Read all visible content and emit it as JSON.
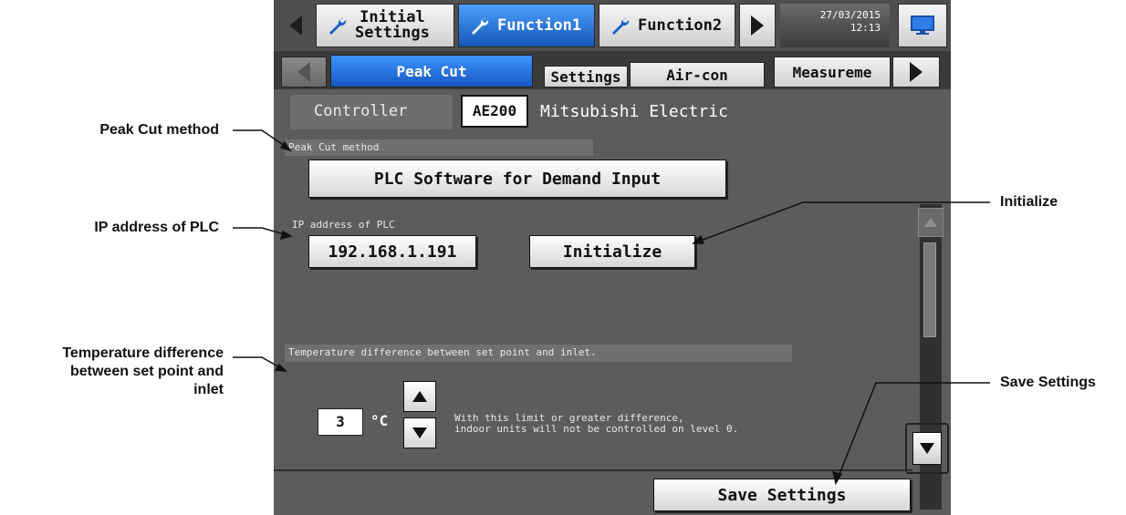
{
  "annotations": {
    "peak_cut_method": "Peak Cut method",
    "ip_address": "IP address of PLC",
    "temp_diff_line1": "Temperature difference",
    "temp_diff_line2": "between set point and",
    "temp_diff_line3": "inlet",
    "initialize": "Initialize",
    "save_settings": "Save Settings"
  },
  "header": {
    "tabs": [
      {
        "line1": "Initial",
        "line2": "Settings"
      },
      {
        "label": "Function1",
        "selected": true
      },
      {
        "label": "Function2"
      }
    ],
    "date": "27/03/2015",
    "time": "12:13",
    "monitor_icon": "monitor-icon"
  },
  "subtabs": {
    "title": "Peak Cut",
    "items": [
      "Settings",
      "Air-con",
      "Measureme"
    ]
  },
  "controller": {
    "label": "Controller",
    "model": "AE200",
    "maker": "Mitsubishi Electric"
  },
  "peak_cut": {
    "section_label": "Peak Cut method",
    "method_value": "PLC Software for Demand Input"
  },
  "ip": {
    "section_label": "IP address of PLC",
    "value": "192.168.1.191",
    "initialize_label": "Initialize"
  },
  "temperature": {
    "section_label": "Temperature difference between set point and inlet.",
    "value": "3",
    "unit": "°C",
    "note_line1": "With this limit or greater difference,",
    "note_line2": "indoor units will not be controlled on level 0."
  },
  "footer": {
    "save_label": "Save Settings"
  },
  "colors": {
    "selected_tab": "#1457b8",
    "screen_bg": "#5c5c5c"
  }
}
